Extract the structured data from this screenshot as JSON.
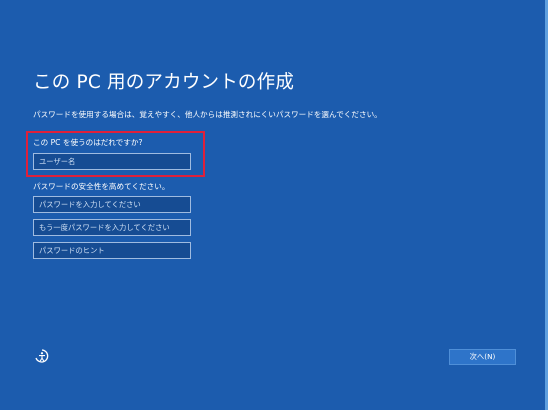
{
  "page": {
    "title": "この PC 用のアカウントの作成",
    "description": "パスワードを使用する場合は、覚えやすく、他人からは推測されにくいパスワードを選んでください。"
  },
  "username": {
    "label": "この PC を使うのはだれですか?",
    "placeholder": "ユーザー名",
    "value": ""
  },
  "password_section": {
    "label": "パスワードの安全性を高めてください。",
    "password_placeholder": "パスワードを入力してください",
    "confirm_placeholder": "もう一度パスワードを入力してください",
    "hint_placeholder": "パスワードのヒント"
  },
  "footer": {
    "next_label": "次へ(N)",
    "accessibility_icon": "ease-of-access-icon"
  },
  "colors": {
    "background": "#1c5cae",
    "highlight_border": "#e0203a",
    "input_background": "#164c93",
    "button_background": "#2e74c9"
  }
}
